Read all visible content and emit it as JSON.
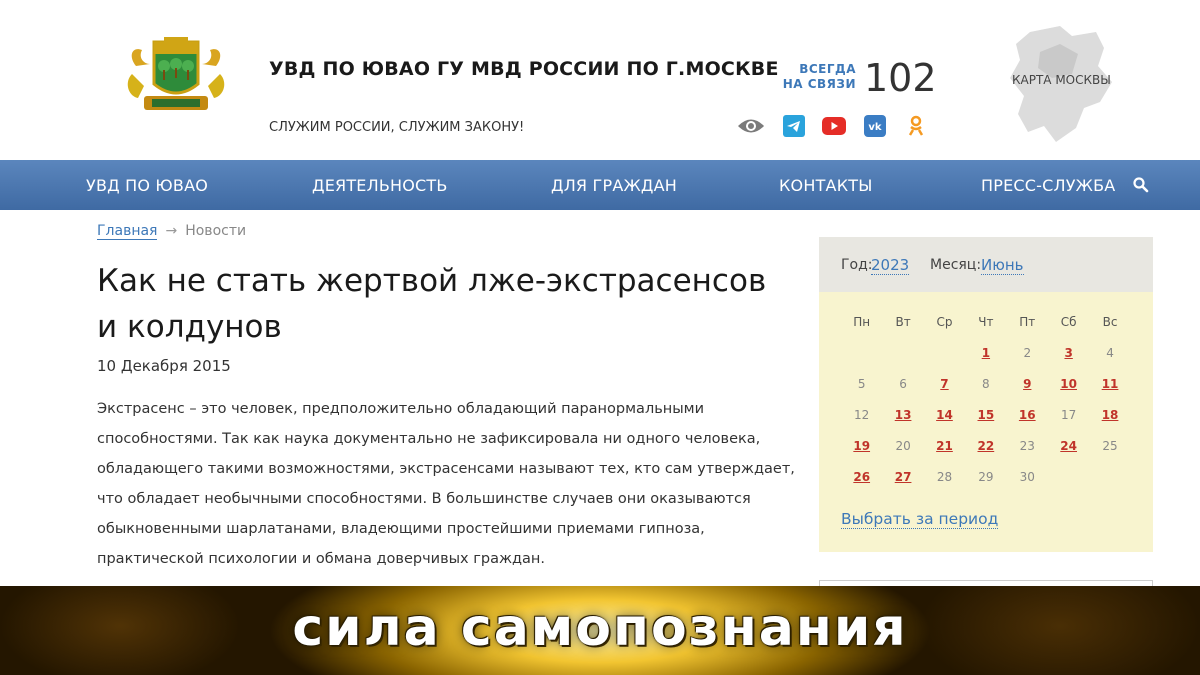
{
  "header": {
    "title": "УВД ПО ЮВАО ГУ МВД РОССИИ ПО Г.МОСКВЕ",
    "slogan": "СЛУЖИМ РОССИИ, СЛУЖИМ ЗАКОНУ!",
    "hotline_label": "ВСЕГДА\nНА СВЯЗИ",
    "hotline_number": "102",
    "map_label": "КАРТА МОСКВЫ",
    "socials": [
      "eye-icon",
      "telegram-icon",
      "youtube-icon",
      "vk-icon",
      "odnoklassniki-icon"
    ]
  },
  "nav": {
    "items": [
      "УВД ПО ЮВАО",
      "ДЕЯТЕЛЬНОСТЬ",
      "ДЛЯ ГРАЖДАН",
      "КОНТАКТЫ",
      "ПРЕСС-СЛУЖБА"
    ],
    "search_icon": "search-icon"
  },
  "breadcrumb": {
    "home": "Главная",
    "arrow": "→",
    "current": "Новости"
  },
  "article": {
    "title": "Как не стать жертвой лже-экстрасенсов и колдунов",
    "date": "10 Декабря 2015",
    "body": "Экстрасенс – это человек, предположительно обладающий паранормальными способностями. Так как наука документально не зафиксировала ни одного человека, обладающего такими возможностями, экстрасенсами называют тех, кто сам утверждает, что обладает необычными способностями. В большинстве случаев они оказываются обыкновенными шарлатанами, владеющими простейшими приемами гипноза, практической психологии и обмана доверчивых граждан."
  },
  "calendar": {
    "year_label": "Год:",
    "year": "2023",
    "month_label": "Месяц:",
    "month": "Июнь",
    "weekdays": [
      "Пн",
      "Вт",
      "Ср",
      "Чт",
      "Пт",
      "Сб",
      "Вс"
    ],
    "weeks": [
      [
        {
          "d": ""
        },
        {
          "d": ""
        },
        {
          "d": ""
        },
        {
          "d": "1",
          "link": true
        },
        {
          "d": "2"
        },
        {
          "d": "3",
          "link": true
        },
        {
          "d": "4"
        }
      ],
      [
        {
          "d": "5"
        },
        {
          "d": "6"
        },
        {
          "d": "7",
          "link": true
        },
        {
          "d": "8"
        },
        {
          "d": "9",
          "link": true
        },
        {
          "d": "10",
          "link": true
        },
        {
          "d": "11",
          "link": true
        }
      ],
      [
        {
          "d": "12"
        },
        {
          "d": "13",
          "link": true
        },
        {
          "d": "14",
          "link": true
        },
        {
          "d": "15",
          "link": true
        },
        {
          "d": "16",
          "link": true
        },
        {
          "d": "17"
        },
        {
          "d": "18",
          "link": true
        }
      ],
      [
        {
          "d": "19",
          "link": true
        },
        {
          "d": "20"
        },
        {
          "d": "21",
          "link": true
        },
        {
          "d": "22",
          "link": true
        },
        {
          "d": "23"
        },
        {
          "d": "24",
          "link": true
        },
        {
          "d": "25"
        }
      ],
      [
        {
          "d": "26",
          "link": true
        },
        {
          "d": "27",
          "link": true
        },
        {
          "d": "28"
        },
        {
          "d": "29"
        },
        {
          "d": "30"
        },
        {
          "d": ""
        },
        {
          "d": ""
        }
      ]
    ],
    "period_link": "Выбрать за период"
  },
  "banner": {
    "text": "сила самопознания"
  },
  "colors": {
    "nav_top": "#5b86bd",
    "nav_bottom": "#3f6aa3",
    "link": "#3d78b8",
    "calendar_bg": "#f8f4cf",
    "calendar_link": "#c0342a",
    "banner_gold": "#f2c531"
  }
}
